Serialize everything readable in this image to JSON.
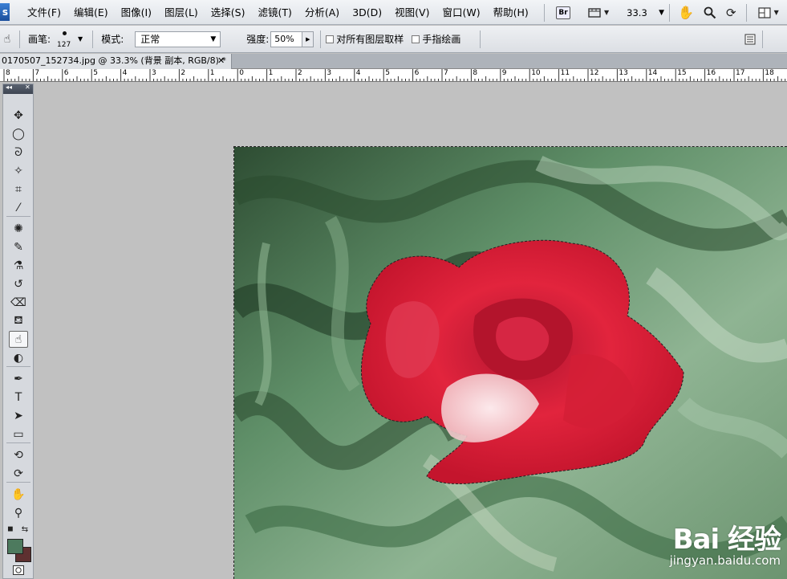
{
  "menu": {
    "logo": "s",
    "items": [
      "文件(F)",
      "编辑(E)",
      "图像(I)",
      "图层(L)",
      "选择(S)",
      "滤镜(T)",
      "分析(A)",
      "3D(D)",
      "视图(V)",
      "窗口(W)",
      "帮助(H)"
    ],
    "bridge_label": "Br",
    "zoom": "33.3"
  },
  "options": {
    "brush_label": "画笔:",
    "brush_size": "127",
    "mode_label": "模式:",
    "mode_value": "正常",
    "strength_label": "强度:",
    "strength_value": "50%",
    "sample_all_layers": "对所有图层取样",
    "finger_painting": "手指绘画"
  },
  "document": {
    "tab_title": "0170507_152734.jpg @ 33.3% (背景 副本, RGB/8) *",
    "close": "✕"
  },
  "ruler": {
    "labels": [
      "8",
      "7",
      "6",
      "5",
      "4",
      "3",
      "2",
      "1",
      "0",
      "1",
      "2",
      "3",
      "4",
      "5",
      "6",
      "7",
      "8",
      "9",
      "10",
      "11",
      "12",
      "13",
      "14",
      "15",
      "16",
      "17",
      "18"
    ]
  },
  "toolbox": {
    "collapse": "◂◂",
    "close": "✕",
    "tools": [
      {
        "name": "move-tool",
        "glyph": "✥",
        "active": false
      },
      {
        "name": "elliptical-marquee-tool",
        "glyph": "◯",
        "active": false
      },
      {
        "name": "lasso-tool",
        "glyph": "ᘐ",
        "active": false
      },
      {
        "name": "magic-wand-tool",
        "glyph": "✧",
        "active": false
      },
      {
        "name": "crop-tool",
        "glyph": "⌗",
        "active": false
      },
      {
        "name": "eyedropper-tool",
        "glyph": "⁄",
        "active": false
      },
      {
        "name": "spot-healing-tool",
        "glyph": "✺",
        "active": false
      },
      {
        "name": "brush-tool",
        "glyph": "✎",
        "active": false
      },
      {
        "name": "clone-stamp-tool",
        "glyph": "⚗",
        "active": false
      },
      {
        "name": "history-brush-tool",
        "glyph": "↺",
        "active": false
      },
      {
        "name": "eraser-tool",
        "glyph": "⌫",
        "active": false
      },
      {
        "name": "paint-bucket-tool",
        "glyph": "⛾",
        "active": false
      },
      {
        "name": "smudge-tool",
        "glyph": "☝",
        "active": true
      },
      {
        "name": "dodge-tool",
        "glyph": "◐",
        "active": false
      },
      {
        "name": "pen-tool",
        "glyph": "✒",
        "active": false
      },
      {
        "name": "type-tool",
        "glyph": "T",
        "active": false
      },
      {
        "name": "path-selection-tool",
        "glyph": "➤",
        "active": false
      },
      {
        "name": "rectangle-tool",
        "glyph": "▭",
        "active": false
      },
      {
        "name": "3d-rotate-tool",
        "glyph": "⟲",
        "active": false
      },
      {
        "name": "3d-orbit-tool",
        "glyph": "⟳",
        "active": false
      },
      {
        "name": "hand-tool",
        "glyph": "✋",
        "active": false
      },
      {
        "name": "zoom-tool",
        "glyph": "⚲",
        "active": false
      }
    ],
    "foreground_color": "#4d7a5e",
    "background_color": "#5e3030"
  },
  "watermark": {
    "logo": "Bai  经验",
    "url": "jingyan.baidu.com"
  }
}
